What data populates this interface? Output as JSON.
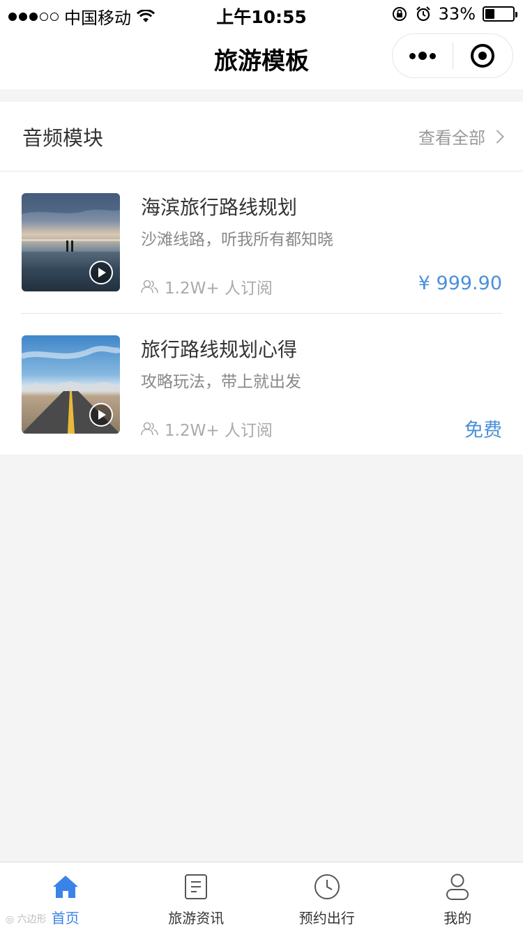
{
  "status_bar": {
    "carrier": "中国移动",
    "time": "上午10:55",
    "battery": "33%",
    "battery_level": 0.33
  },
  "nav": {
    "title": "旅游模板"
  },
  "audio_section": {
    "title": "音频模块",
    "view_all": "查看全部",
    "items": [
      {
        "title": "海滨旅行路线规划",
        "desc": "沙滩线路，听我所有都知晓",
        "subscribers": "1.2W+ 人订阅",
        "price": "¥ 999.90"
      },
      {
        "title": "旅行路线规划心得",
        "desc": "攻略玩法，带上就出发",
        "subscribers": "1.2W+ 人订阅",
        "price": "免费"
      }
    ]
  },
  "tab_bar": {
    "tabs": [
      {
        "label": "首页",
        "icon": "home-icon",
        "active": true
      },
      {
        "label": "旅游资讯",
        "icon": "document-icon",
        "active": false
      },
      {
        "label": "预约出行",
        "icon": "clock-icon",
        "active": false
      },
      {
        "label": "我的",
        "icon": "user-icon",
        "active": false
      }
    ]
  },
  "colors": {
    "accent": "#3a83e8",
    "price": "#4a90d9",
    "background": "#f4f4f4"
  }
}
